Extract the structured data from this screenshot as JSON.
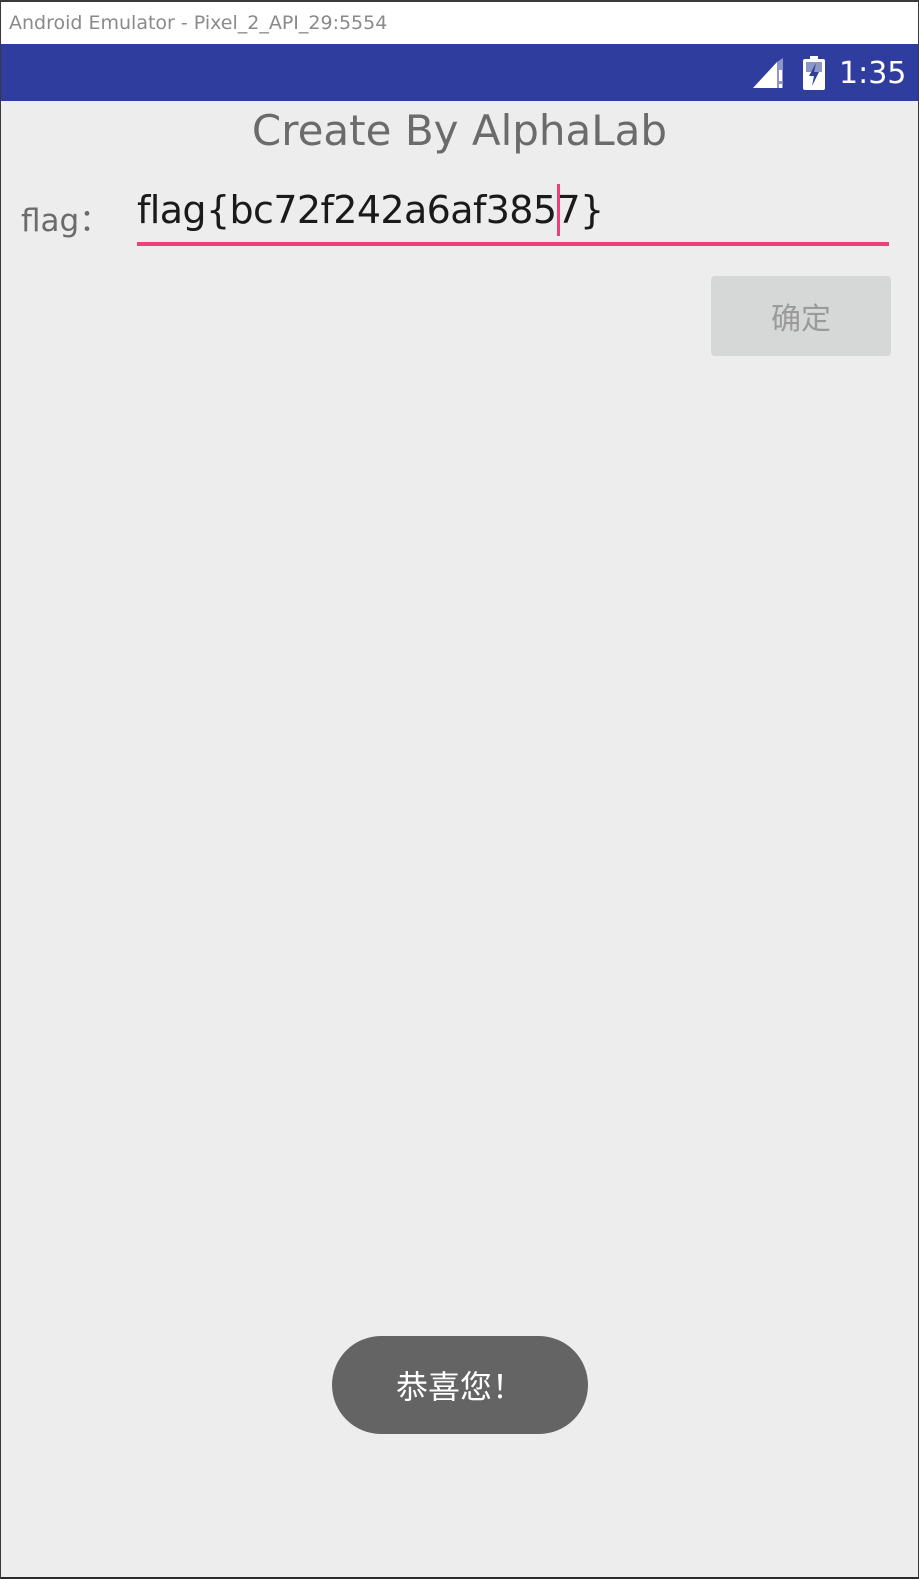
{
  "window": {
    "title": "Android Emulator - Pixel_2_API_29:5554"
  },
  "statusbar": {
    "time": "1:35",
    "signal_icon": "cell-signal-no-data-icon",
    "battery_icon": "battery-charging-icon",
    "background_color": "#2f3e9e"
  },
  "app": {
    "title": "Create By AlphaLab",
    "flag_label": "flag：",
    "flag_value": "flag{bc72f242a6af3857}",
    "confirm_label": "确定",
    "accent_color": "#ec407a"
  },
  "toast": {
    "message": "恭喜您！"
  }
}
